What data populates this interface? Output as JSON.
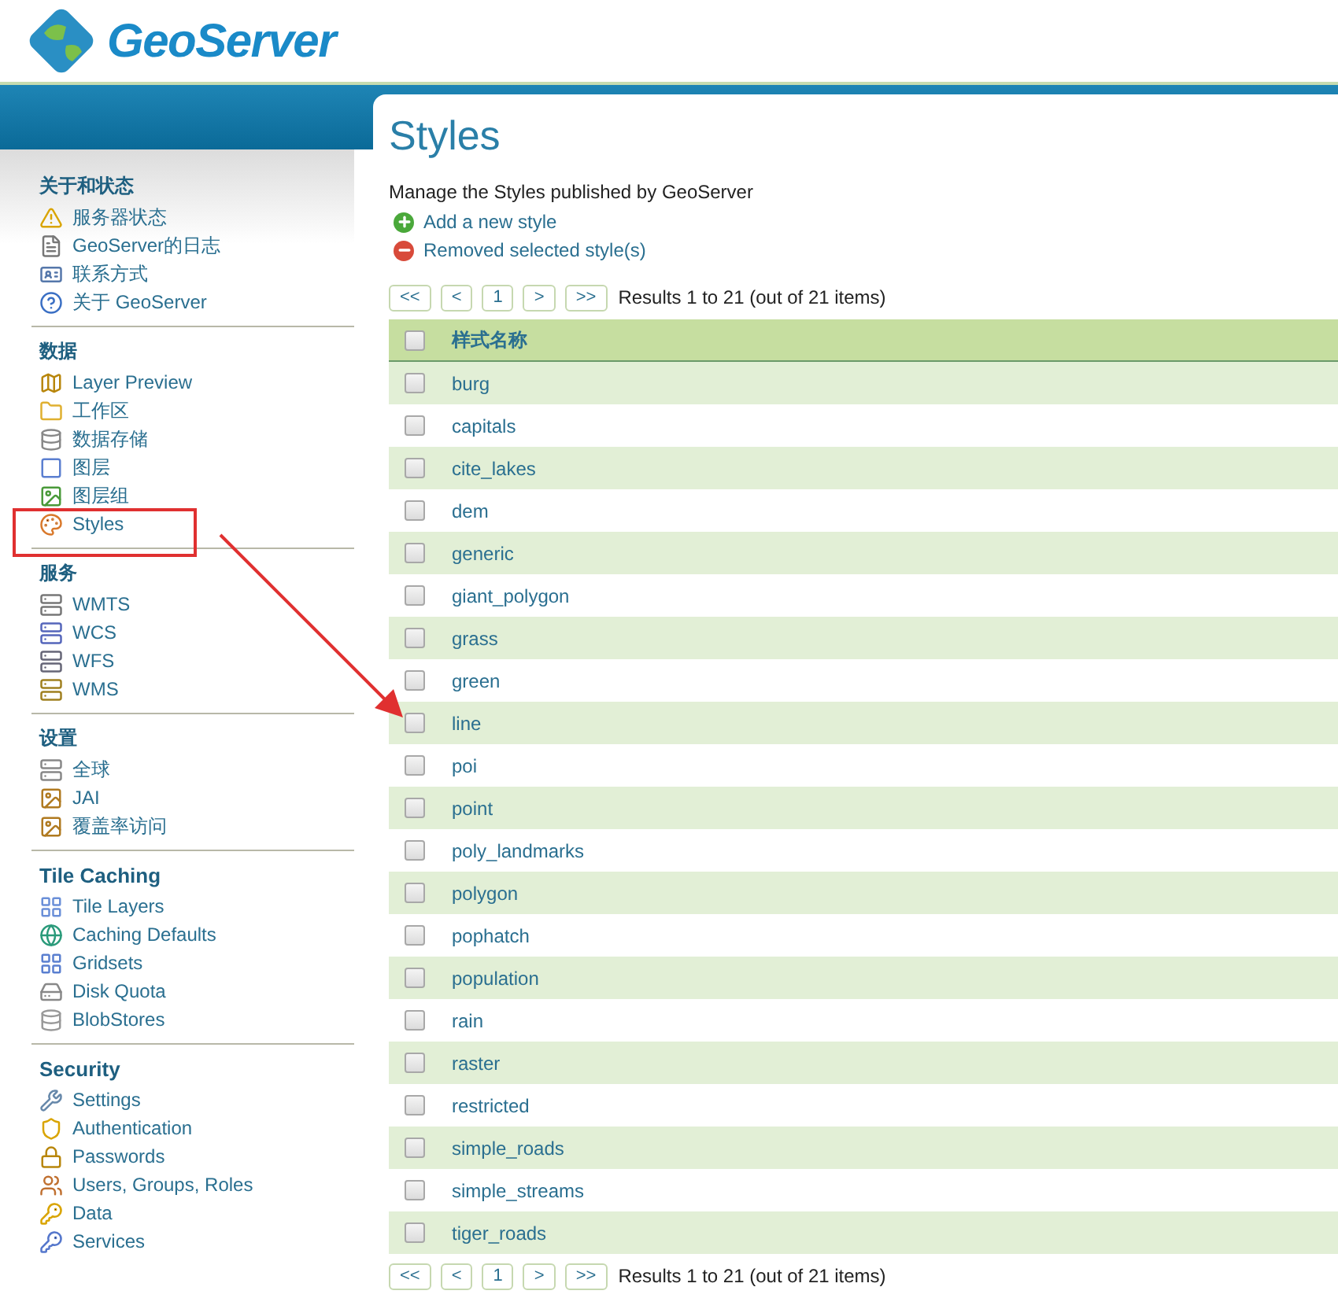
{
  "logo": {
    "text": "GeoServer"
  },
  "sidebar": {
    "sections": [
      {
        "title": "关于和状态",
        "items": [
          {
            "label": "服务器状态"
          },
          {
            "label": "GeoServer的日志"
          },
          {
            "label": "联系方式"
          },
          {
            "label": "关于 GeoServer"
          }
        ]
      },
      {
        "title": "数据",
        "items": [
          {
            "label": "Layer Preview"
          },
          {
            "label": "工作区"
          },
          {
            "label": "数据存储"
          },
          {
            "label": "图层"
          },
          {
            "label": "图层组"
          },
          {
            "label": "Styles"
          }
        ]
      },
      {
        "title": "服务",
        "items": [
          {
            "label": "WMTS"
          },
          {
            "label": "WCS"
          },
          {
            "label": "WFS"
          },
          {
            "label": "WMS"
          }
        ]
      },
      {
        "title": "设置",
        "items": [
          {
            "label": "全球"
          },
          {
            "label": "JAI"
          },
          {
            "label": "覆盖率访问"
          }
        ]
      },
      {
        "title": "Tile Caching",
        "items": [
          {
            "label": "Tile Layers"
          },
          {
            "label": "Caching Defaults"
          },
          {
            "label": "Gridsets"
          },
          {
            "label": "Disk Quota"
          },
          {
            "label": "BlobStores"
          }
        ]
      },
      {
        "title": "Security",
        "items": [
          {
            "label": "Settings"
          },
          {
            "label": "Authentication"
          },
          {
            "label": "Passwords"
          },
          {
            "label": "Users, Groups, Roles"
          },
          {
            "label": "Data"
          },
          {
            "label": "Services"
          }
        ]
      }
    ]
  },
  "page": {
    "title": "Styles",
    "description": "Manage the Styles published by GeoServer",
    "actions": [
      {
        "kind": "add",
        "label": "Add a new style"
      },
      {
        "kind": "remove",
        "label": "Removed selected style(s)"
      }
    ],
    "pager": {
      "buttons": [
        "<<",
        "<",
        "1",
        ">",
        ">>"
      ],
      "summary": "Results 1 to 21 (out of 21 items)"
    },
    "table": {
      "column": "样式名称",
      "header_checked": false,
      "rows": [
        {
          "name": "burg",
          "checked": false
        },
        {
          "name": "capitals",
          "checked": false
        },
        {
          "name": "cite_lakes",
          "checked": false
        },
        {
          "name": "dem",
          "checked": false
        },
        {
          "name": "generic",
          "checked": false
        },
        {
          "name": "giant_polygon",
          "checked": false
        },
        {
          "name": "grass",
          "checked": false
        },
        {
          "name": "green",
          "checked": false
        },
        {
          "name": "line",
          "checked": false
        },
        {
          "name": "poi",
          "checked": false
        },
        {
          "name": "point",
          "checked": false
        },
        {
          "name": "poly_landmarks",
          "checked": false
        },
        {
          "name": "polygon",
          "checked": false
        },
        {
          "name": "pophatch",
          "checked": false
        },
        {
          "name": "population",
          "checked": false
        },
        {
          "name": "rain",
          "checked": false
        },
        {
          "name": "raster",
          "checked": false
        },
        {
          "name": "restricted",
          "checked": false
        },
        {
          "name": "simple_roads",
          "checked": false
        },
        {
          "name": "simple_streams",
          "checked": false
        },
        {
          "name": "tiger_roads",
          "checked": false
        }
      ]
    },
    "pager_bottom": {
      "buttons": [
        "<<",
        "<",
        "1",
        ">",
        ">>"
      ],
      "summary": "Results 1 to 21 (out of 21 items)"
    }
  }
}
